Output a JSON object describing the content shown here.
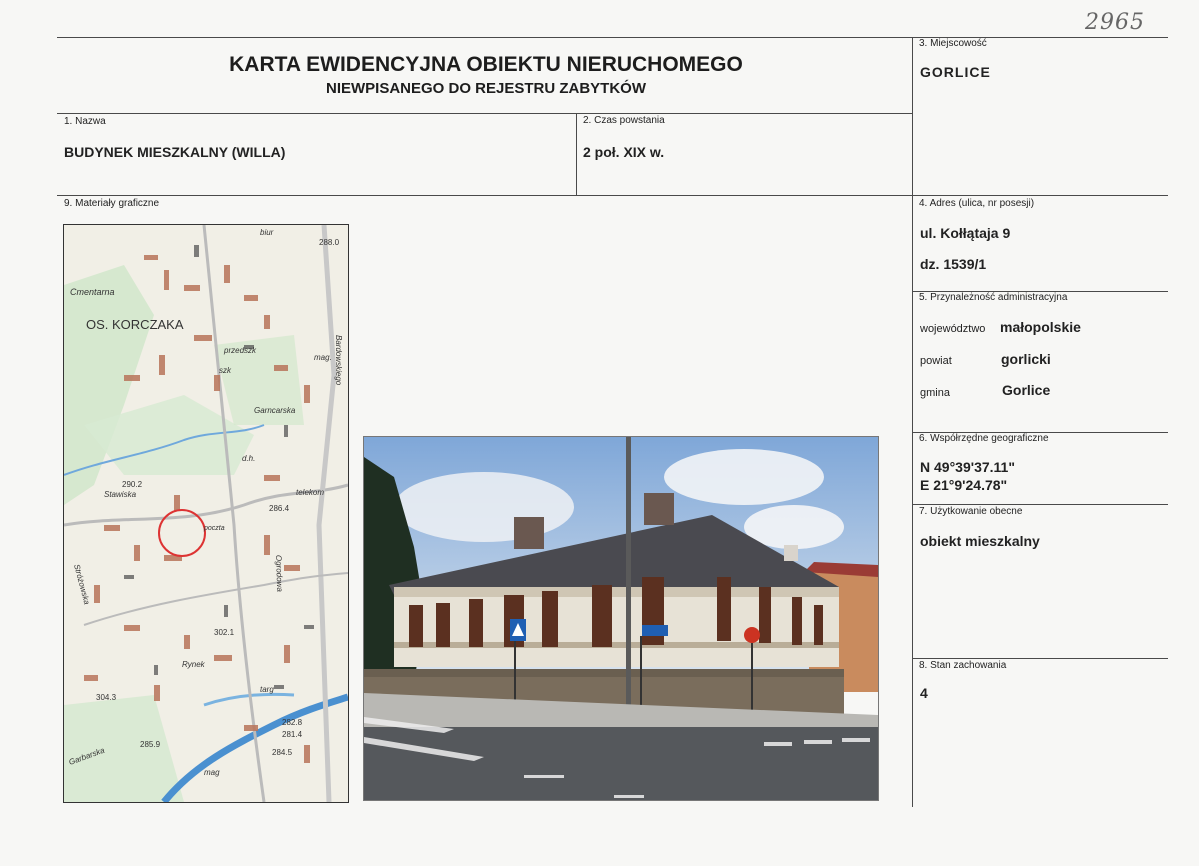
{
  "header": {
    "title": "KARTA EWIDENCYJNA OBIEKTU NIERUCHOMEGO",
    "subtitle": "NIEWPISANEGO DO REJESTRU ZABYTKÓW",
    "handwritten_number": "2965"
  },
  "fields": {
    "nazwa": {
      "label": "1. Nazwa",
      "value": "BUDYNEK MIESZKALNY (WILLA)"
    },
    "czas": {
      "label": "2. Czas powstania",
      "value": "2 poł. XIX w."
    },
    "miejscowosc": {
      "label": "3. Miejscowość",
      "value": "GORLICE"
    },
    "adres": {
      "label": "4. Adres (ulica, nr posesji)",
      "line1": "ul. Kołłątaja 9",
      "line2": "dz. 1539/1"
    },
    "przynaleznosc": {
      "label": "5. Przynależność administracyjna",
      "wojewodztwo_label": "województwo",
      "wojewodztwo": "małopolskie",
      "powiat_label": "powiat",
      "powiat": "gorlicki",
      "gmina_label": "gmina",
      "gmina": "Gorlice"
    },
    "wspolrzedne": {
      "label": "6. Współrzędne geograficzne",
      "n": "N 49°39'37.11\"",
      "e": "E 21°9'24.78\""
    },
    "uzytkowanie": {
      "label": "7. Użytkowanie obecne",
      "value": "obiekt mieszkalny"
    },
    "stan": {
      "label": "8. Stan zachowania",
      "value": "4"
    },
    "materialy": {
      "label": "9. Materiały graficzne"
    }
  },
  "map": {
    "labels": {
      "osiedle": "OS. KORCZAKA",
      "cmentarz": "Cmentarna",
      "elev1": "288.0",
      "elev2": "290.2",
      "elev3": "286.4",
      "elev4": "302.1",
      "elev5": "304.3",
      "elev6": "285.9",
      "elev7": "282.8",
      "elev8": "281.4",
      "elev9": "284.5",
      "s1": "biur",
      "s2": "przedszk",
      "s3": "mag.",
      "s4": "szk",
      "s5": "Garncarska",
      "s6": "Stawiska",
      "s7": "Stróżowska",
      "s8": "Ogrodowa",
      "s9": "Bardowskiego",
      "s10": "targ",
      "s11": "Rynek",
      "s12": "Garbarska",
      "s13": "mag",
      "s14": "poczta",
      "s15": "telekom",
      "s16": "d.h."
    }
  },
  "colors": {
    "line": "#4a4a4a",
    "map_marker": "#d33"
  }
}
